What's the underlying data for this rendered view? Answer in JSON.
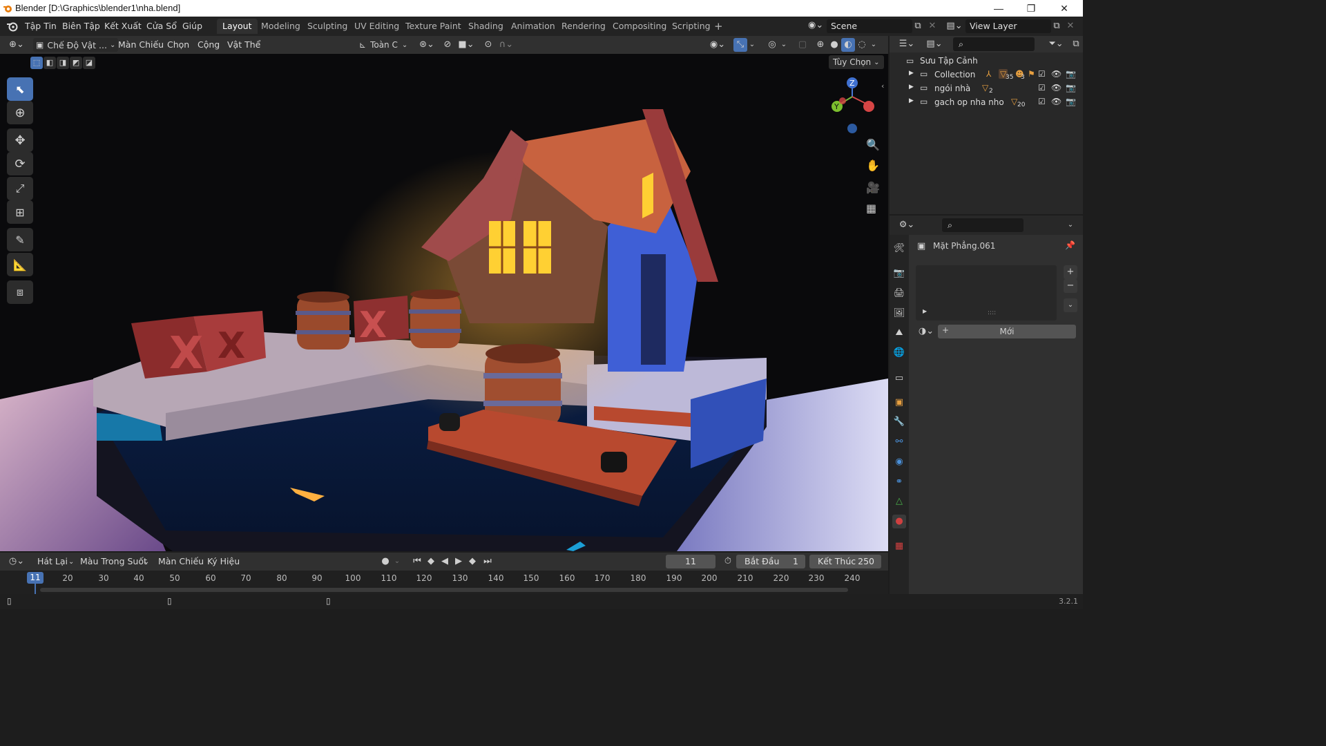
{
  "window": {
    "title": "Blender [D:\\Graphics\\blender1\\nha.blend]",
    "minimize": "—",
    "maximize": "❐",
    "close": "✕"
  },
  "menu": {
    "items": [
      "Tập Tin",
      "Biên Tập",
      "Kết Xuất",
      "Cửa Sổ",
      "Giúp"
    ],
    "workspaces": [
      "Layout",
      "Modeling",
      "Sculpting",
      "UV Editing",
      "Texture Paint",
      "Shading",
      "Animation",
      "Rendering",
      "Compositing",
      "Scripting"
    ],
    "active_workspace": "Layout",
    "add_workspace": "+",
    "scene": "Scene",
    "view_layer": "View Layer"
  },
  "viewport_header": {
    "mode": "Chế Độ Vật ...",
    "menus": [
      "Màn Chiếu",
      "Chọn",
      "Cộng",
      "Vật Thể"
    ],
    "transform_orientation": "Toàn C",
    "options": "Tùy Chọn"
  },
  "gizmo": {
    "z": "Z",
    "y": "Y"
  },
  "outliner": {
    "root": "Sưu Tập Cảnh",
    "collections": [
      {
        "name": "Collection",
        "badge": "35",
        "badge2": "3"
      },
      {
        "name": "ngói nhà",
        "badge": "2"
      },
      {
        "name": "gach op nha nho",
        "badge": "20"
      }
    ]
  },
  "properties": {
    "object_name": "Mặt Phẳng.061",
    "new_button": "Mới",
    "dots": "::::"
  },
  "timeline": {
    "menus": [
      "Hát Lại",
      "Màu Trong Suốt",
      "Màn Chiếu",
      "Ký Hiệu"
    ],
    "current_frame": "11",
    "start_label": "Bắt Đầu",
    "start_value": "1",
    "end_label": "Kết Thúc",
    "end_value": "250",
    "ruler": [
      "20",
      "30",
      "40",
      "50",
      "60",
      "70",
      "80",
      "90",
      "100",
      "110",
      "120",
      "130",
      "140",
      "150",
      "160",
      "170",
      "180",
      "190",
      "200",
      "210",
      "220",
      "230",
      "240"
    ],
    "playhead": "11"
  },
  "status": {
    "version": "3.2.1"
  },
  "colors": {
    "accent": "#4772b3",
    "window_glow": "#ffcc33"
  }
}
